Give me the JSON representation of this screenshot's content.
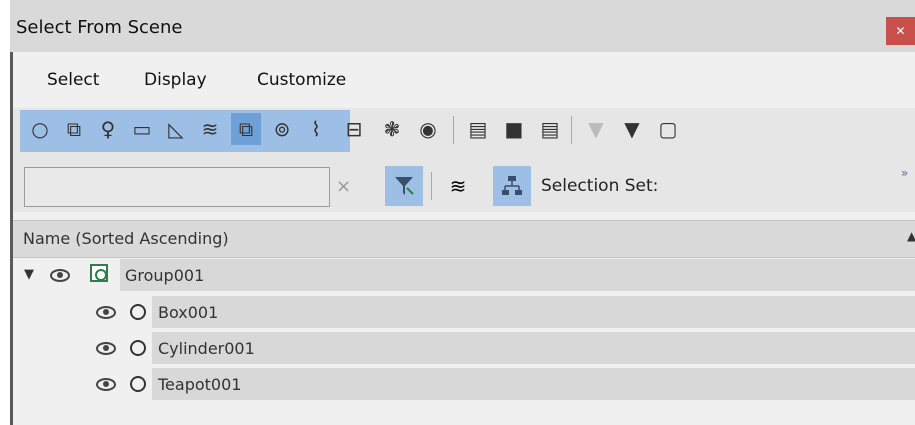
{
  "window": {
    "title": "Select From Scene"
  },
  "menu": {
    "items": [
      "Select",
      "Display",
      "Customize"
    ]
  },
  "toolbar": {
    "filter_icons": [
      "geometry-icon",
      "shapes-icon",
      "lights-icon",
      "cameras-icon",
      "helpers-icon",
      "space-warps-icon",
      "groups-icon",
      "xrefs-icon",
      "bones-icon",
      "containers-icon",
      "frozen-icon",
      "hidden-icon"
    ],
    "search_placeholder": "",
    "clear_symbol": "×",
    "selection_set_label": "Selection Set:",
    "more_symbol": "»"
  },
  "list": {
    "column_header": "Name (Sorted Ascending)",
    "sort_arrow": "▲",
    "rows": [
      {
        "name": "Group001",
        "type": "group",
        "expanded": true
      },
      {
        "name": "Box001",
        "type": "geometry"
      },
      {
        "name": "Cylinder001",
        "type": "geometry"
      },
      {
        "name": "Teapot001",
        "type": "geometry"
      }
    ]
  },
  "colors": {
    "active_filter": "#6fa1d8",
    "filter_bg": "#9dbfe6",
    "close_button": "#c9504a",
    "group_icon": "#2e7d4a"
  }
}
